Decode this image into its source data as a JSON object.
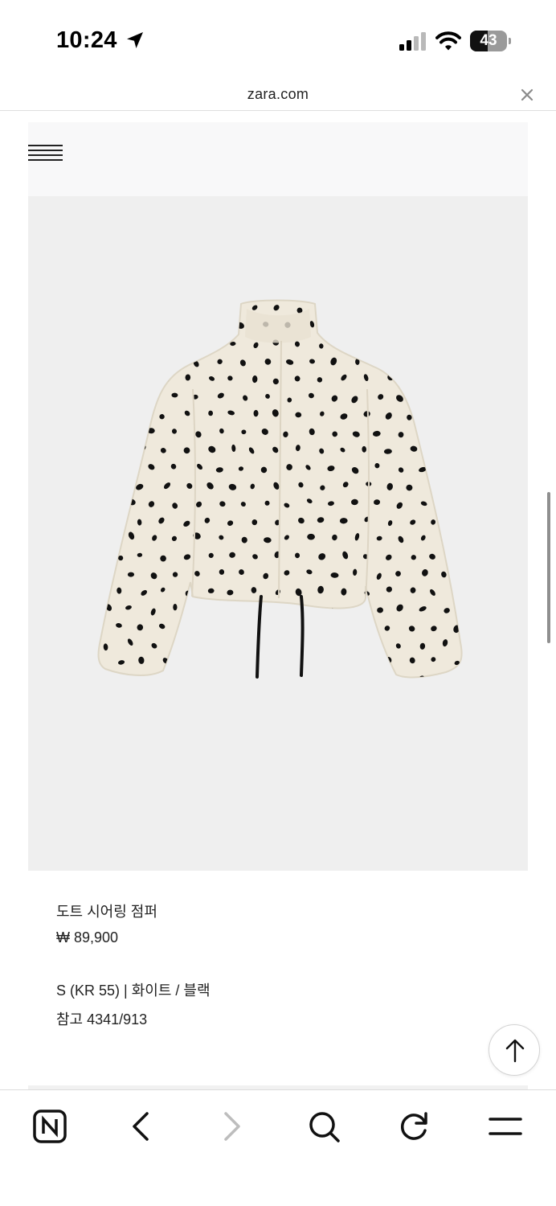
{
  "status_bar": {
    "time": "10:24",
    "battery": "43",
    "icons": [
      "location-arrow-icon",
      "signal-icon",
      "wifi-icon",
      "battery-icon"
    ]
  },
  "browser": {
    "url": "zara.com",
    "toolbar_icons": [
      "naver-icon",
      "back-icon",
      "forward-icon",
      "search-icon",
      "reload-icon",
      "menu-icon"
    ]
  },
  "product": {
    "name": "도트 시어링 점퍼",
    "price": "₩ 89,900",
    "variant": "S (KR 55) | 화이트 / 블랙",
    "reference": "참고 4341/913"
  },
  "colors": {
    "image_background": "#efefef",
    "header_background": "#f8f8f9",
    "jacket": "#efe9dc",
    "dots": "#111111"
  }
}
